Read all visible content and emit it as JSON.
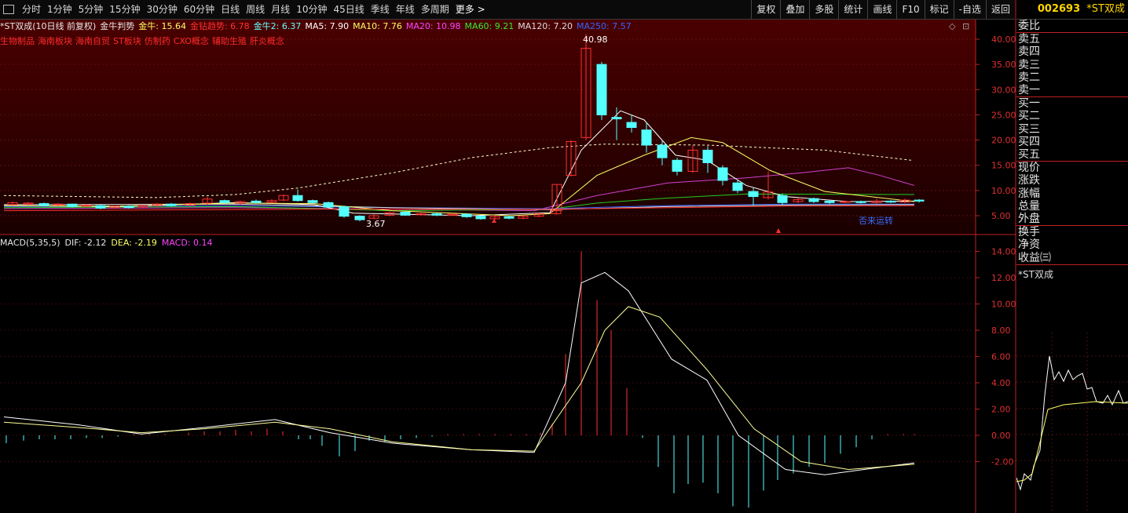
{
  "toolbar": {
    "left": [
      "分时",
      "1分钟",
      "5分钟",
      "15分钟",
      "30分钟",
      "60分钟",
      "日线",
      "周线",
      "月线",
      "10分钟",
      "45日线",
      "季线",
      "年线",
      "多周期"
    ],
    "more": "更多",
    "right": [
      "复权",
      "叠加",
      "多股",
      "统计",
      "画线",
      "F10",
      "标记",
      "-自选",
      "返回"
    ]
  },
  "info": {
    "title": "*ST双成(10日线 前复权)",
    "indicator": "金牛判势",
    "items": [
      {
        "label": "金牛: 15.64",
        "color": "#ffff66"
      },
      {
        "label": "金钻趋势: 6.78",
        "color": "#ff3030"
      },
      {
        "label": "金牛2: 6.37",
        "color": "#66ffff"
      },
      {
        "label": "MA5: 7.90",
        "color": "#ffffff"
      },
      {
        "label": "MA10: 7.76",
        "color": "#ffff66"
      },
      {
        "label": "MA20: 10.98",
        "color": "#ff44ff"
      },
      {
        "label": "MA60: 9.21",
        "color": "#33ee33"
      },
      {
        "label": "MA120: 7.20",
        "color": "#dddddd"
      },
      {
        "label": "MA250: 7.57",
        "color": "#3366ff"
      }
    ]
  },
  "concepts": [
    "生物制品",
    "海南板块",
    "海南自贸",
    "ST板块",
    "仿制药",
    "CXO概念",
    "辅助生殖",
    "肝炎概念"
  ],
  "price_axis": [
    "40.00",
    "35.00",
    "30.00",
    "25.00",
    "20.00",
    "15.00",
    "10.00",
    "5.00"
  ],
  "annotations": {
    "high": "40.98",
    "low": "3.67",
    "signal": "否来运转"
  },
  "macd": {
    "label": "MACD(5,35,5)",
    "dif": "DIF: -2.12",
    "dea": "DEA: -2.19",
    "macd": "MACD: 0.14",
    "axis": [
      "14.00",
      "12.00",
      "10.00",
      "8.00",
      "6.00",
      "4.00",
      "2.00",
      "0.00",
      "-2.00"
    ]
  },
  "side": {
    "code": "002693",
    "name": "*ST双成",
    "order_rows": [
      "委比"
    ],
    "sell_rows": [
      "卖五",
      "卖四",
      "卖三",
      "卖二",
      "卖一"
    ],
    "buy_rows": [
      "买一",
      "买二",
      "买三",
      "买四",
      "买五"
    ],
    "quote_rows": [
      "现价",
      "涨跌",
      "涨幅",
      "总量",
      "外盘"
    ],
    "extra_rows": [
      "换手",
      "净资",
      "收益㈢"
    ],
    "mini_title": "*ST双成"
  },
  "colors": {
    "up": "#ff3030",
    "down": "#54ffff",
    "axis": "#c02020",
    "bg_top": "#3a0000"
  }
}
